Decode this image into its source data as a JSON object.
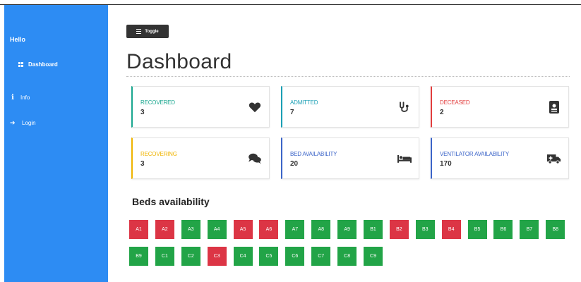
{
  "sidebar": {
    "hello": "Hello",
    "items": [
      {
        "label": "Dashboard",
        "icon": "grid-icon"
      },
      {
        "label": "Info",
        "icon": "info-icon"
      },
      {
        "label": "Login",
        "icon": "login-icon"
      }
    ],
    "background": "#2d8cf3"
  },
  "toggle": {
    "label": "Toggle",
    "icon": "hamburger-icon"
  },
  "page_title": "Dashboard",
  "cards": [
    {
      "label": "RECOVERED",
      "value": "3",
      "color": "#1aa78f",
      "icon": "heart-icon"
    },
    {
      "label": "ADMITTED",
      "value": "7",
      "color": "#1a9fb5",
      "icon": "stethoscope-icon"
    },
    {
      "label": "DECEASED",
      "value": "2",
      "color": "#e23d3d",
      "icon": "id-card-icon"
    },
    {
      "label": "RECOVERING",
      "value": "3",
      "color": "#f0b400",
      "icon": "comments-icon"
    },
    {
      "label": "BED AVAILABILITY",
      "value": "20",
      "color": "#3b64c8",
      "icon": "bed-icon"
    },
    {
      "label": "VENTILATOR AVAILABILITY",
      "value": "170",
      "color": "#3b64c8",
      "icon": "ambulance-icon"
    }
  ],
  "beds_title": "Beds availability",
  "beds": [
    {
      "label": "A1",
      "status": "occupied"
    },
    {
      "label": "A2",
      "status": "occupied"
    },
    {
      "label": "A3",
      "status": "available"
    },
    {
      "label": "A4",
      "status": "available"
    },
    {
      "label": "A5",
      "status": "occupied"
    },
    {
      "label": "A6",
      "status": "occupied"
    },
    {
      "label": "A7",
      "status": "available"
    },
    {
      "label": "A8",
      "status": "available"
    },
    {
      "label": "A9",
      "status": "available"
    },
    {
      "label": "B1",
      "status": "available"
    },
    {
      "label": "B2",
      "status": "occupied"
    },
    {
      "label": "B3",
      "status": "available"
    },
    {
      "label": "B4",
      "status": "occupied"
    },
    {
      "label": "B5",
      "status": "available"
    },
    {
      "label": "B6",
      "status": "available"
    },
    {
      "label": "B7",
      "status": "available"
    },
    {
      "label": "B8",
      "status": "available"
    },
    {
      "label": "B9",
      "status": "available"
    },
    {
      "label": "C1",
      "status": "available"
    },
    {
      "label": "C2",
      "status": "available"
    },
    {
      "label": "C3",
      "status": "occupied"
    },
    {
      "label": "C4",
      "status": "available"
    },
    {
      "label": "C5",
      "status": "available"
    },
    {
      "label": "C6",
      "status": "available"
    },
    {
      "label": "C7",
      "status": "available"
    },
    {
      "label": "C8",
      "status": "available"
    },
    {
      "label": "C9",
      "status": "available"
    }
  ],
  "status_colors": {
    "available": "#22a447",
    "occupied": "#dc3545"
  }
}
